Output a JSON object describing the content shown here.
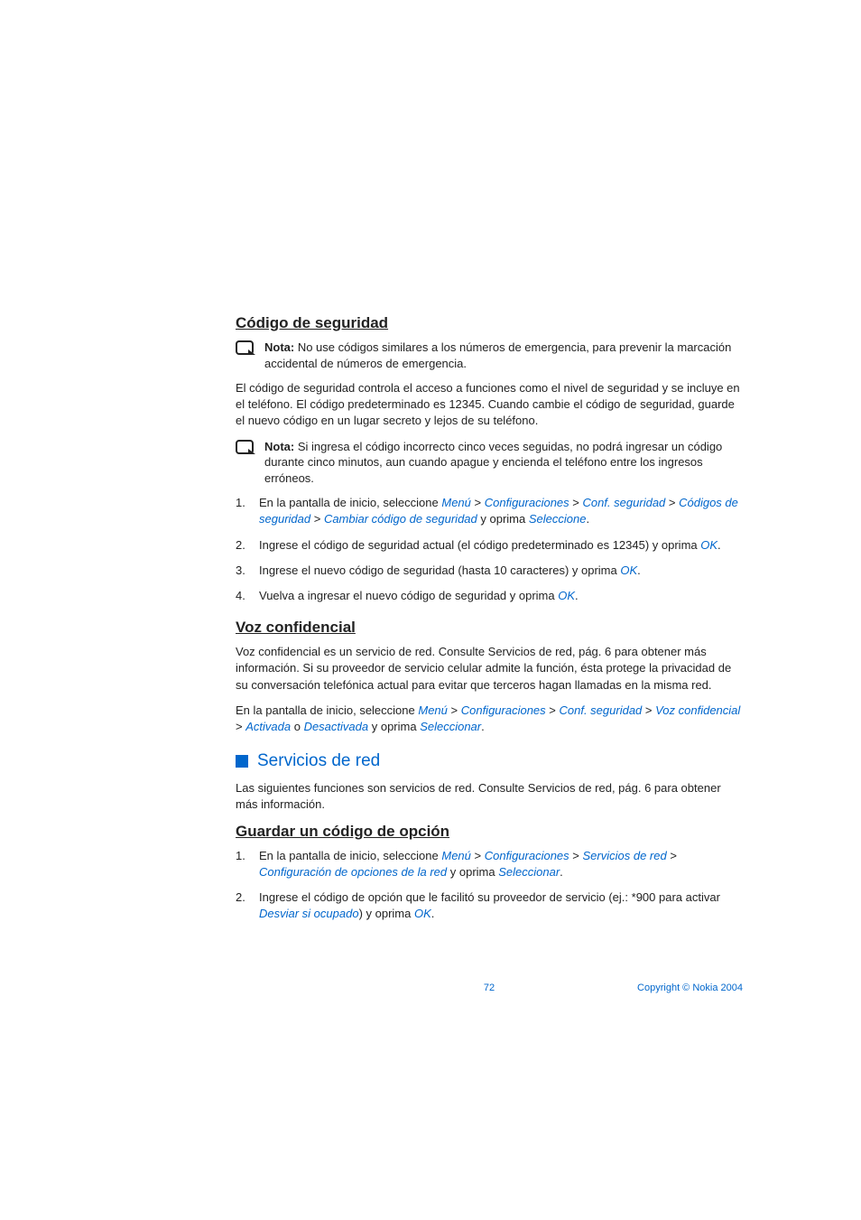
{
  "h_codigo": "Código de seguridad",
  "note1_bold": "Nota:",
  "note1_text": " No use códigos similares a los números de emergencia, para prevenir la marcación accidental de números de emergencia.",
  "p_codigo": "El código de seguridad controla el acceso a funciones como el nivel de seguridad y se incluye en el teléfono. El código predeterminado es 12345. Cuando cambie el código de seguridad, guarde el nuevo código en un lugar secreto y lejos de su teléfono.",
  "note2_bold": "Nota:",
  "note2_text": " Si ingresa el código incorrecto cinco veces seguidas, no podrá ingresar un código durante cinco minutos, aun cuando apague y encienda el teléfono entre los ingresos erróneos.",
  "ol1_li1_a": "En la pantalla de inicio, seleccione ",
  "menu": "Menú",
  "gt": " > ",
  "config": "Configuraciones",
  "confseg": "Conf. seguridad",
  "codseg": "Códigos de seguridad",
  "cambcod": "Cambiar código de seguridad",
  "yoprima": " y oprima ",
  "seleccione": "Seleccione",
  "period": ".",
  "ol1_li2_a": "Ingrese el código de seguridad actual (el código predeterminado es 12345) y oprima ",
  "ok": "OK",
  "ol1_li3_a": "Ingrese el nuevo código de seguridad (hasta 10 caracteres) y oprima ",
  "ol1_li4_a": "Vuelva a ingresar el nuevo código de seguridad y oprima ",
  "h_voz": "Voz confidencial",
  "p_voz": "Voz confidencial es un servicio de red. Consulte Servicios de red, pág. 6 para obtener más información. Si su proveedor de servicio celular admite la función, ésta protege la privacidad de su conversación telefónica actual para evitar que terceros hagan llamadas en la misma red.",
  "p_voz2_a": "En la pantalla de inicio, seleccione ",
  "vozconf": "Voz confidencial",
  "activada": "Activada",
  "o": " o ",
  "desactivada": "Desactivada",
  "seleccionar": "Seleccionar",
  "h_servicios": "Servicios de red",
  "p_serv": "Las siguientes funciones son servicios de red. Consulte Servicios de red, pág. 6 para obtener más información.",
  "h_guardar": "Guardar un código de opción",
  "ol2_li1_a": "En la pantalla de inicio, seleccione ",
  "servred": "Servicios de red",
  "configop": "Configuración de opciones de la red",
  "ol2_li2_a": "Ingrese el código de opción que le facilitó su proveedor de servicio (ej.: *900 para activar ",
  "desviar": "Desviar si ocupado",
  "ol2_li2_b": ") y oprima ",
  "page_number": "72",
  "copyright": "Copyright © Nokia 2004"
}
